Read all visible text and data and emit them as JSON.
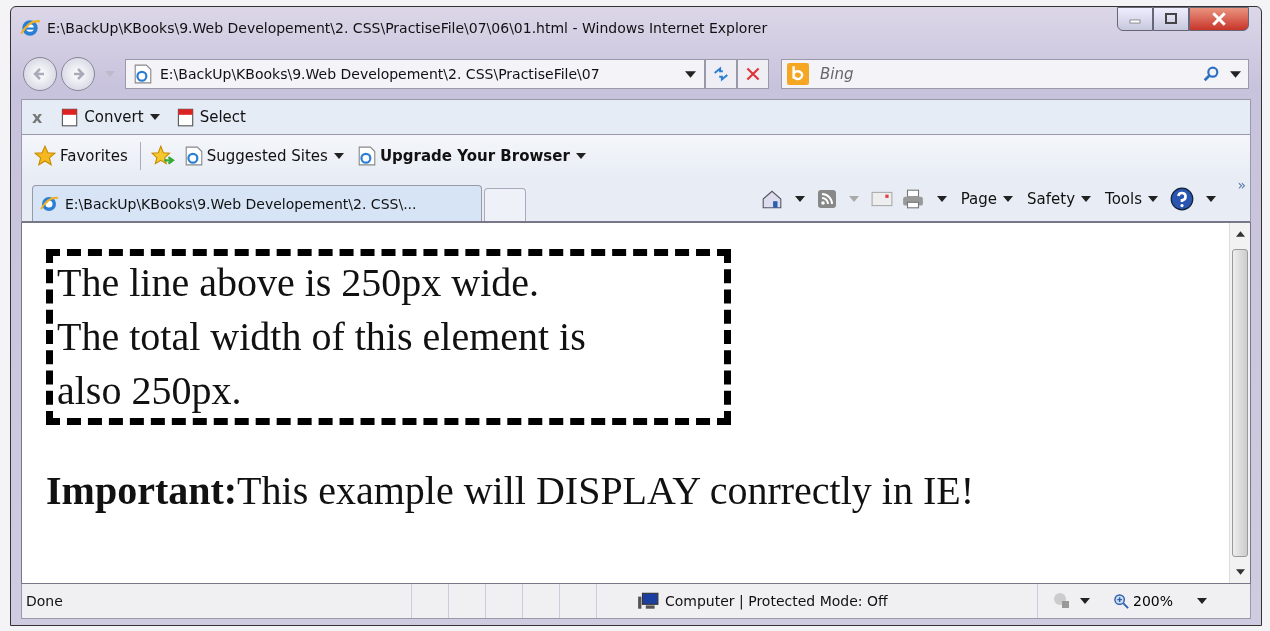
{
  "window": {
    "title": "E:\\BackUp\\KBooks\\9.Web Developement\\2. CSS\\PractiseFile\\07\\06\\01.html - Windows Internet Explorer"
  },
  "address_bar": {
    "value": "E:\\BackUp\\KBooks\\9.Web Developement\\2. CSS\\PractiseFile\\07"
  },
  "search": {
    "placeholder": "Bing"
  },
  "toolbar": {
    "close": "x",
    "items": [
      {
        "label": "Convert",
        "dropdown": true
      },
      {
        "label": "Select",
        "dropdown": false
      }
    ]
  },
  "favorites_bar": {
    "favorites": "Favorites",
    "items": [
      {
        "label": "Suggested Sites",
        "bold": false
      },
      {
        "label": "Upgrade Your Browser",
        "bold": true
      }
    ]
  },
  "tabs": [
    {
      "label": "E:\\BackUp\\KBooks\\9.Web Developement\\2. CSS\\...",
      "selected": true
    }
  ],
  "command_bar": [
    "Page",
    "Safety",
    "Tools"
  ],
  "more": "»",
  "content": {
    "box_lines": [
      "The line above is 250px wide.",
      "The total width of this element is",
      "also 250px."
    ],
    "note": "**Important:**This example will DISPLAY conrrectly in IE!"
  },
  "status_bar": {
    "text": "Done",
    "zone": "Computer | Protected Mode: Off",
    "zoom": "200%"
  }
}
